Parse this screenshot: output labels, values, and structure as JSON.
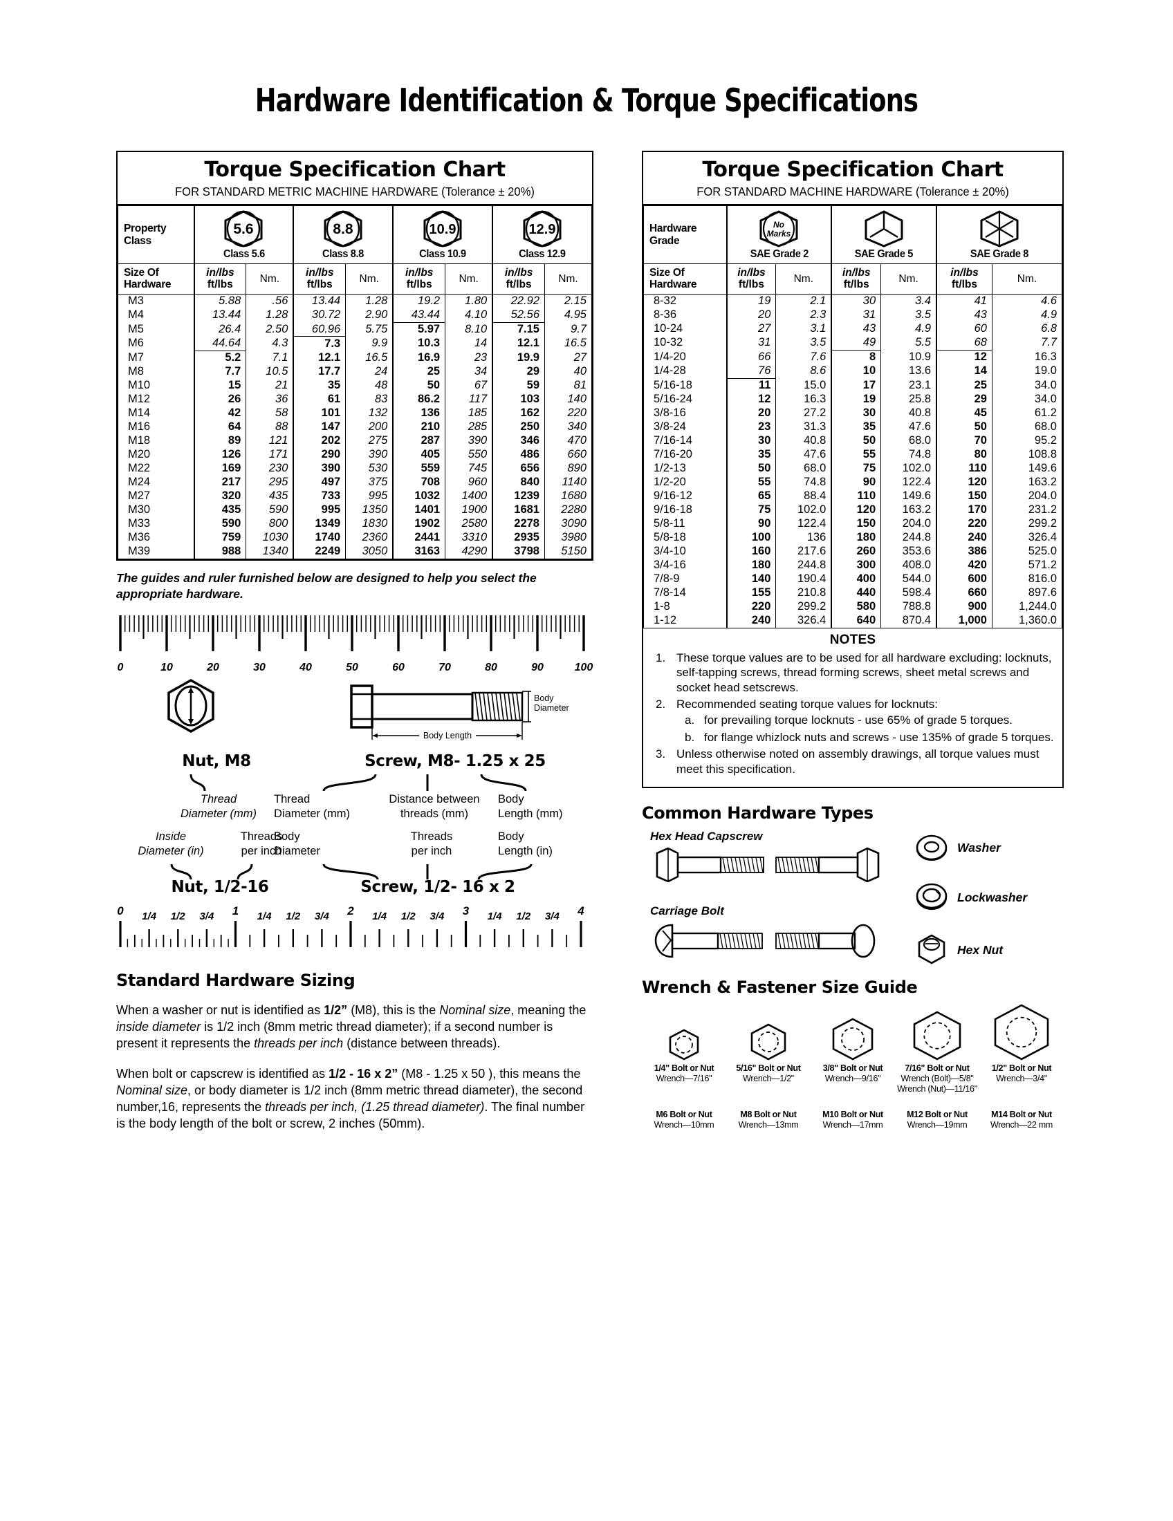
{
  "title": "Hardware Identification  &  Torque Specifications",
  "metric_table": {
    "title": "Torque Specification Chart",
    "subtitle": "FOR STANDARD METRIC MACHINE HARDWARE (Tolerance ± 20%)",
    "grade_header": "Property\nClass",
    "grade_header_line1": "Property",
    "grade_header_line2": "Class",
    "size_header_line1": "Size Of",
    "size_header_line2": "Hardware",
    "unit_inlbs": "in/lbs",
    "unit_ftlbs": "ft/lbs",
    "unit_nm": "Nm.",
    "grades": [
      {
        "mark": "5.6",
        "label": "Class 5.6"
      },
      {
        "mark": "8.8",
        "label": "Class 8.8"
      },
      {
        "mark": "10.9",
        "label": "Class 10.9"
      },
      {
        "mark": "12.9",
        "label": "Class 12.9"
      }
    ],
    "rows": [
      {
        "size": "M3",
        "c": [
          "5.88",
          ".56",
          "13.44",
          "1.28",
          "19.2",
          "1.80",
          "22.92",
          "2.15"
        ]
      },
      {
        "size": "M4",
        "c": [
          "13.44",
          "1.28",
          "30.72",
          "2.90",
          "43.44",
          "4.10",
          "52.56",
          "4.95"
        ]
      },
      {
        "size": "M5",
        "c": [
          "26.4",
          "2.50",
          "60.96",
          "5.75",
          "5.97",
          "8.10",
          "7.15",
          "9.7"
        ]
      },
      {
        "size": "M6",
        "c": [
          "44.64",
          "4.3",
          "7.3",
          "9.9",
          "10.3",
          "14",
          "12.1",
          "16.5"
        ]
      },
      {
        "size": "M7",
        "c": [
          "5.2",
          "7.1",
          "12.1",
          "16.5",
          "16.9",
          "23",
          "19.9",
          "27"
        ]
      },
      {
        "size": "M8",
        "c": [
          "7.7",
          "10.5",
          "17.7",
          "24",
          "25",
          "34",
          "29",
          "40"
        ]
      },
      {
        "size": "M10",
        "c": [
          "15",
          "21",
          "35",
          "48",
          "50",
          "67",
          "59",
          "81"
        ]
      },
      {
        "size": "M12",
        "c": [
          "26",
          "36",
          "61",
          "83",
          "86.2",
          "117",
          "103",
          "140"
        ]
      },
      {
        "size": "M14",
        "c": [
          "42",
          "58",
          "101",
          "132",
          "136",
          "185",
          "162",
          "220"
        ]
      },
      {
        "size": "M16",
        "c": [
          "64",
          "88",
          "147",
          "200",
          "210",
          "285",
          "250",
          "340"
        ]
      },
      {
        "size": "M18",
        "c": [
          "89",
          "121",
          "202",
          "275",
          "287",
          "390",
          "346",
          "470"
        ]
      },
      {
        "size": "M20",
        "c": [
          "126",
          "171",
          "290",
          "390",
          "405",
          "550",
          "486",
          "660"
        ]
      },
      {
        "size": "M22",
        "c": [
          "169",
          "230",
          "390",
          "530",
          "559",
          "745",
          "656",
          "890"
        ]
      },
      {
        "size": "M24",
        "c": [
          "217",
          "295",
          "497",
          "375",
          "708",
          "960",
          "840",
          "1140"
        ]
      },
      {
        "size": "M27",
        "c": [
          "320",
          "435",
          "733",
          "995",
          "1032",
          "1400",
          "1239",
          "1680"
        ]
      },
      {
        "size": "M30",
        "c": [
          "435",
          "590",
          "995",
          "1350",
          "1401",
          "1900",
          "1681",
          "2280"
        ]
      },
      {
        "size": "M33",
        "c": [
          "590",
          "800",
          "1349",
          "1830",
          "1902",
          "2580",
          "2278",
          "3090"
        ]
      },
      {
        "size": "M36",
        "c": [
          "759",
          "1030",
          "1740",
          "2360",
          "2441",
          "3310",
          "2935",
          "3980"
        ]
      },
      {
        "size": "M39",
        "c": [
          "988",
          "1340",
          "2249",
          "3050",
          "3163",
          "4290",
          "3798",
          "5150"
        ]
      }
    ],
    "unit_break_after_row": {
      "c0": 3,
      "c2": 2,
      "c4": 1,
      "c6": 1
    }
  },
  "sae_table": {
    "title": "Torque Specification Chart",
    "subtitle": "FOR STANDARD MACHINE HARDWARE (Tolerance ± 20%)",
    "grade_header_line1": "Hardware",
    "grade_header_line2": "Grade",
    "size_header_line1": "Size Of",
    "size_header_line2": "Hardware",
    "unit_inlbs": "in/lbs",
    "unit_ftlbs": "ft/lbs",
    "unit_nm": "Nm.",
    "grades": [
      {
        "mark": "No Marks",
        "label": "SAE Grade 2",
        "marks": 0
      },
      {
        "mark": "",
        "label": "SAE Grade 5",
        "marks": 3
      },
      {
        "mark": "",
        "label": "SAE Grade 8",
        "marks": 6
      }
    ],
    "rows": [
      {
        "size": "8-32",
        "c": [
          "19",
          "2.1",
          "30",
          "3.4",
          "41",
          "4.6"
        ]
      },
      {
        "size": "8-36",
        "c": [
          "20",
          "2.3",
          "31",
          "3.5",
          "43",
          "4.9"
        ]
      },
      {
        "size": "10-24",
        "c": [
          "27",
          "3.1",
          "43",
          "4.9",
          "60",
          "6.8"
        ]
      },
      {
        "size": "10-32",
        "c": [
          "31",
          "3.5",
          "49",
          "5.5",
          "68",
          "7.7"
        ]
      },
      {
        "size": "1/4-20",
        "c": [
          "66",
          "7.6",
          "8",
          "10.9",
          "12",
          "16.3"
        ]
      },
      {
        "size": "1/4-28",
        "c": [
          "76",
          "8.6",
          "10",
          "13.6",
          "14",
          "19.0"
        ]
      },
      {
        "size": "5/16-18",
        "c": [
          "11",
          "15.0",
          "17",
          "23.1",
          "25",
          "34.0"
        ]
      },
      {
        "size": "5/16-24",
        "c": [
          "12",
          "16.3",
          "19",
          "25.8",
          "29",
          "34.0"
        ]
      },
      {
        "size": "3/8-16",
        "c": [
          "20",
          "27.2",
          "30",
          "40.8",
          "45",
          "61.2"
        ]
      },
      {
        "size": "3/8-24",
        "c": [
          "23",
          "31.3",
          "35",
          "47.6",
          "50",
          "68.0"
        ]
      },
      {
        "size": "7/16-14",
        "c": [
          "30",
          "40.8",
          "50",
          "68.0",
          "70",
          "95.2"
        ]
      },
      {
        "size": "7/16-20",
        "c": [
          "35",
          "47.6",
          "55",
          "74.8",
          "80",
          "108.8"
        ]
      },
      {
        "size": "1/2-13",
        "c": [
          "50",
          "68.0",
          "75",
          "102.0",
          "110",
          "149.6"
        ]
      },
      {
        "size": "1/2-20",
        "c": [
          "55",
          "74.8",
          "90",
          "122.4",
          "120",
          "163.2"
        ]
      },
      {
        "size": "9/16-12",
        "c": [
          "65",
          "88.4",
          "110",
          "149.6",
          "150",
          "204.0"
        ]
      },
      {
        "size": "9/16-18",
        "c": [
          "75",
          "102.0",
          "120",
          "163.2",
          "170",
          "231.2"
        ]
      },
      {
        "size": "5/8-11",
        "c": [
          "90",
          "122.4",
          "150",
          "204.0",
          "220",
          "299.2"
        ]
      },
      {
        "size": "5/8-18",
        "c": [
          "100",
          "136",
          "180",
          "244.8",
          "240",
          "326.4"
        ]
      },
      {
        "size": "3/4-10",
        "c": [
          "160",
          "217.6",
          "260",
          "353.6",
          "386",
          "525.0"
        ]
      },
      {
        "size": "3/4-16",
        "c": [
          "180",
          "244.8",
          "300",
          "408.0",
          "420",
          "571.2"
        ]
      },
      {
        "size": "7/8-9",
        "c": [
          "140",
          "190.4",
          "400",
          "544.0",
          "600",
          "816.0"
        ]
      },
      {
        "size": "7/8-14",
        "c": [
          "155",
          "210.8",
          "440",
          "598.4",
          "660",
          "897.6"
        ]
      },
      {
        "size": "1-8",
        "c": [
          "220",
          "299.2",
          "580",
          "788.8",
          "900",
          "1,244.0"
        ]
      },
      {
        "size": "1-12",
        "c": [
          "240",
          "326.4",
          "640",
          "870.4",
          "1,000",
          "1,360.0"
        ]
      }
    ],
    "unit_break_after_row": {
      "c0": 5,
      "c2": 3,
      "c4": 3
    }
  },
  "notes": {
    "heading": "NOTES",
    "items": [
      {
        "text": "These torque values are to be used for all hardware excluding: locknuts, self-tapping screws, thread forming screws, sheet metal screws and socket head setscrews."
      },
      {
        "text": "Recommended seating torque values for locknuts:",
        "sub": [
          "for prevailing torque locknuts - use 65% of grade 5 torques.",
          "for flange whizlock nuts and screws - use 135% of grade 5 torques."
        ]
      },
      {
        "text": "Unless otherwise noted on assembly drawings, all torque values must meet this specification."
      }
    ]
  },
  "guide_note": "The guides and ruler furnished below are designed to help you select the appropriate hardware.",
  "mm_ruler": {
    "labels": [
      "0",
      "10",
      "20",
      "30",
      "40",
      "50",
      "60",
      "70",
      "80",
      "90",
      "100"
    ]
  },
  "in_ruler": {
    "labels": [
      "0",
      "1/4",
      "1/2",
      "3/4",
      "1",
      "1/4",
      "1/2",
      "3/4",
      "2",
      "1/4",
      "1/2",
      "3/4",
      "3",
      "1/4",
      "1/2",
      "3/4",
      "4"
    ]
  },
  "metric_diagram": {
    "nut_caption": "Nut, M8",
    "screw_caption": "Screw, M8- 1.25 x 25",
    "body_diameter_label": "Body\nDiameter",
    "body_diameter_l1": "Body",
    "body_diameter_l2": "Diameter",
    "body_length_label": "Body Length"
  },
  "callouts": {
    "nut_top_l1": "Thread",
    "nut_top_l2": "Diameter (mm)",
    "nut_bot_left_l1": "Inside",
    "nut_bot_left_l2": "Diameter (in)",
    "nut_bot_right_l1": "Threads",
    "nut_bot_right_l2": "per inch",
    "nut_bottom_caption": "Nut, 1/2-16",
    "screw_top_1_l1": "Thread",
    "screw_top_1_l2": "Diameter (mm)",
    "screw_top_2_l1": "Distance between",
    "screw_top_2_l2": "threads (mm)",
    "screw_top_3_l1": "Body",
    "screw_top_3_l2": "Length (mm)",
    "screw_bot_1_l1": "Body",
    "screw_bot_1_l2": "Diameter",
    "screw_bot_2_l1": "Threads",
    "screw_bot_2_l2": "per inch",
    "screw_bot_3_l1": "Body",
    "screw_bot_3_l2": "Length (in)",
    "screw_bottom_caption": "Screw, 1/2- 16 x 2"
  },
  "sizing": {
    "heading": "Standard Hardware Sizing",
    "p1_a": "When a washer or nut is identified as ",
    "p1_b": "1/2”",
    "p1_c": " (M8), this is the ",
    "p1_d": "Nominal size",
    "p1_e": ", meaning the ",
    "p1_f": "inside diameter",
    "p1_g": " is 1/2 inch (8mm metric thread diameter); if a second number is present it represents the ",
    "p1_h": "threads per inch",
    "p1_i": " (distance between threads).",
    "p2_a": "When bolt or capscrew is identified as ",
    "p2_b": "1/2 - 16 x 2”",
    "p2_c": " (M8 - 1.25 x 50 ), this means the ",
    "p2_d": "Nominal size",
    "p2_e": ", or body diameter is 1/2 inch (8mm metric thread diameter), the second number,16, represents the ",
    "p2_f": "threads per inch, (1.25 thread diameter)",
    "p2_g": ". The final number is the body length of the bolt or screw, 2 inches (50mm)."
  },
  "hardware_types": {
    "heading": "Common Hardware Types",
    "left": [
      {
        "label": "Hex Head Capscrew"
      },
      {
        "label": "Carriage Bolt"
      }
    ],
    "right": [
      {
        "label": "Washer"
      },
      {
        "label": "Lockwasher"
      },
      {
        "label": "Hex Nut"
      }
    ]
  },
  "wrench_guide": {
    "heading": "Wrench & Fastener Size Guide",
    "imperial": [
      {
        "title": "1/4\" Bolt or Nut",
        "sub": [
          "Wrench—7/16\""
        ]
      },
      {
        "title": "5/16\" Bolt or Nut",
        "sub": [
          "Wrench—1/2\""
        ]
      },
      {
        "title": "3/8\" Bolt or Nut",
        "sub": [
          "Wrench—9/16\""
        ]
      },
      {
        "title": "7/16\" Bolt or Nut",
        "sub": [
          "Wrench (Bolt)—5/8\"",
          "Wrench (Nut)—11/16\""
        ]
      },
      {
        "title": "1/2\" Bolt or Nut",
        "sub": [
          "Wrench—3/4\""
        ]
      }
    ],
    "metric": [
      {
        "title": "M6 Bolt or Nut",
        "sub": [
          "Wrench—10mm"
        ]
      },
      {
        "title": "M8 Bolt or Nut",
        "sub": [
          "Wrench—13mm"
        ]
      },
      {
        "title": "M10 Bolt or Nut",
        "sub": [
          "Wrench—17mm"
        ]
      },
      {
        "title": "M12 Bolt or Nut",
        "sub": [
          "Wrench—19mm"
        ]
      },
      {
        "title": "M14 Bolt or Nut",
        "sub": [
          "Wrench—22 mm"
        ]
      }
    ],
    "hex_sizes": [
      46,
      54,
      62,
      72,
      82
    ]
  }
}
